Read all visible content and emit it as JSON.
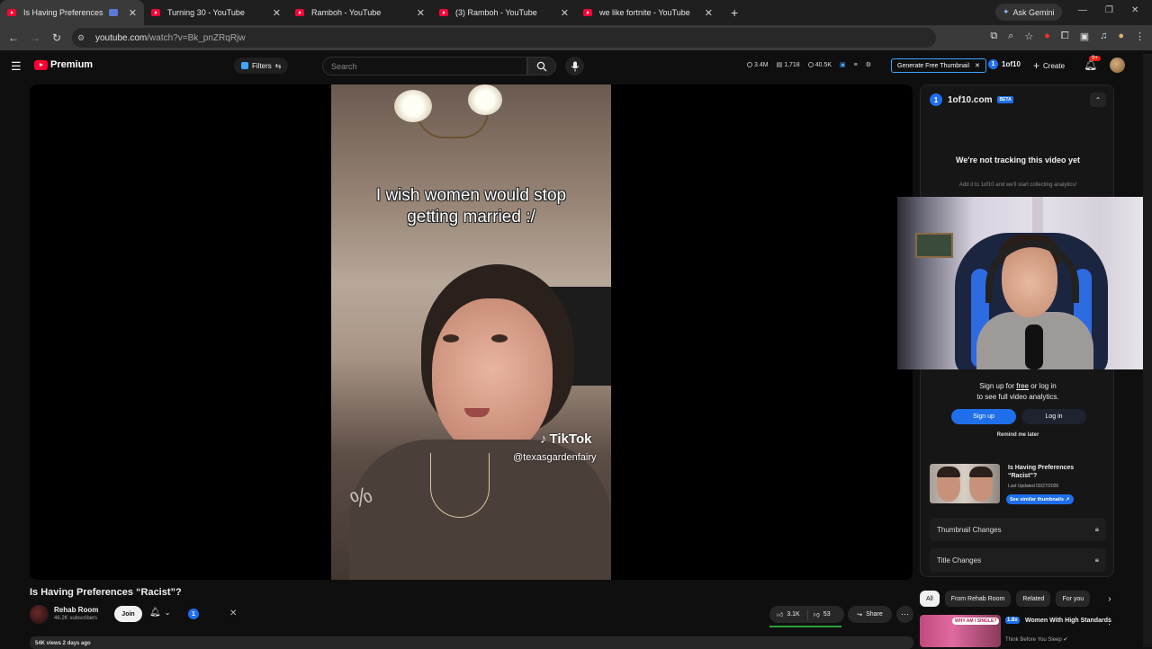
{
  "browser": {
    "tabs": [
      {
        "title": "Is Having Preferences “Raci",
        "active": true
      },
      {
        "title": "Turning 30 - YouTube",
        "active": false
      },
      {
        "title": "Ramboh - YouTube",
        "active": false
      },
      {
        "title": "(3) Ramboh - YouTube",
        "active": false
      },
      {
        "title": "we like fortnite - YouTube",
        "active": false
      }
    ],
    "ask_gemini": "Ask Gemini",
    "url_host": "youtube.com",
    "url_path": "/watch?v=Bk_pnZRqRjw"
  },
  "header": {
    "logo_text": "Premium",
    "filters_label": "Filters",
    "search_placeholder": "Search",
    "stats": {
      "views": "3.4M",
      "count": "1,718",
      "subs": "40.5K"
    },
    "generate_thumbnail": "Generate Free Thumbnail",
    "oneof_label": "1of10",
    "create_label": "Create",
    "notification_count": "9+"
  },
  "video": {
    "caption_line1": "I wish women would stop",
    "caption_line2": "getting married :/",
    "tiktok_brand": "TikTok",
    "tiktok_handle": "@texasgardenfairy",
    "title": "Is Having Preferences “Racist”?",
    "views_line": "54K views  2 days ago"
  },
  "channel": {
    "name": "Rehab Room",
    "subscribers": "46.2K subscribers",
    "join_label": "Join",
    "badge": "1"
  },
  "actions": {
    "likes": "3.1K",
    "dislikes": "53",
    "share_label": "Share",
    "like_ratio": 0.98
  },
  "panel": {
    "site": "1of10.com",
    "beta": "BETA",
    "badge": "1",
    "not_tracking": "We're not tracking this video yet",
    "add_it": "Add it to 1of10 and we'll start collecting analytics!",
    "signup_text_a": "Sign up for ",
    "signup_text_free": "free",
    "signup_text_b": " or log in",
    "signup_text_line2": "to see full video analytics.",
    "signup_button": "Sign up",
    "login_button": "Log in",
    "remind_later": "Remind me later",
    "thumb_title": "Is Having Preferences “Racist”?",
    "thumb_updated": "Last Updated 03/27/2026",
    "see_similar": "See similar thumbnails",
    "thumbnail_changes": "Thumbnail Changes",
    "title_changes": "Title Changes"
  },
  "related": {
    "chips": [
      "All",
      "From Rehab Room",
      "Related",
      "For you"
    ],
    "item": {
      "multiplier": "1.8x",
      "title": "Women With High Standards",
      "channel": "Think Before You Sleep",
      "thumb_text": "WHY AM I SINGLE?"
    }
  },
  "colors": {
    "youtube_red": "#ff0033",
    "accent_blue": "#1f6feb",
    "background": "#0f0f0f",
    "like_bar_green": "#2aa33a"
  }
}
